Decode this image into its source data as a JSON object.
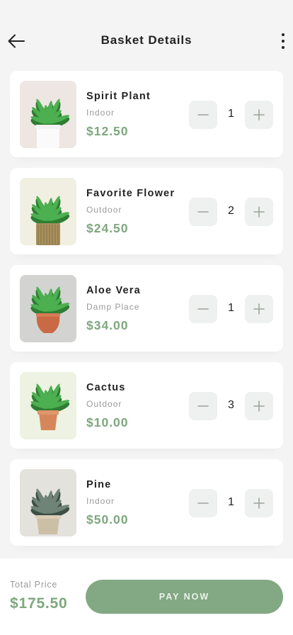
{
  "header": {
    "title": "Basket Details",
    "back_icon": "arrow-left-icon",
    "menu_icon": "more-vertical-icon"
  },
  "items": [
    {
      "name": "Spirit Plant",
      "category": "Indoor",
      "price": "$12.50",
      "quantity": "1",
      "image_bg": "#ede6e2",
      "pot": "white"
    },
    {
      "name": "Favorite Flower",
      "category": "Outdoor",
      "price": "$24.50",
      "quantity": "2",
      "image_bg": "#f1efe2",
      "pot": "ribbed"
    },
    {
      "name": "Aloe Vera",
      "category": "Damp Place",
      "price": "$34.00",
      "quantity": "1",
      "image_bg": "#d3d3d2",
      "pot": "terracotta-round"
    },
    {
      "name": "Cactus",
      "category": "Outdoor",
      "price": "$10.00",
      "quantity": "3",
      "image_bg": "#eef2e2",
      "pot": "terracotta"
    },
    {
      "name": "Pine",
      "category": "Indoor",
      "price": "$50.00",
      "quantity": "1",
      "image_bg": "#e4e2dd",
      "pot": "basket"
    }
  ],
  "icons": {
    "minus": "minus-icon",
    "plus": "plus-icon"
  },
  "footer": {
    "total_label": "Total Price",
    "total_value": "$175.50",
    "pay_label": "PAY NOW"
  },
  "colors": {
    "accent": "#7ea77e",
    "button": "#82a884",
    "qty_button_bg": "#eef1ef"
  }
}
